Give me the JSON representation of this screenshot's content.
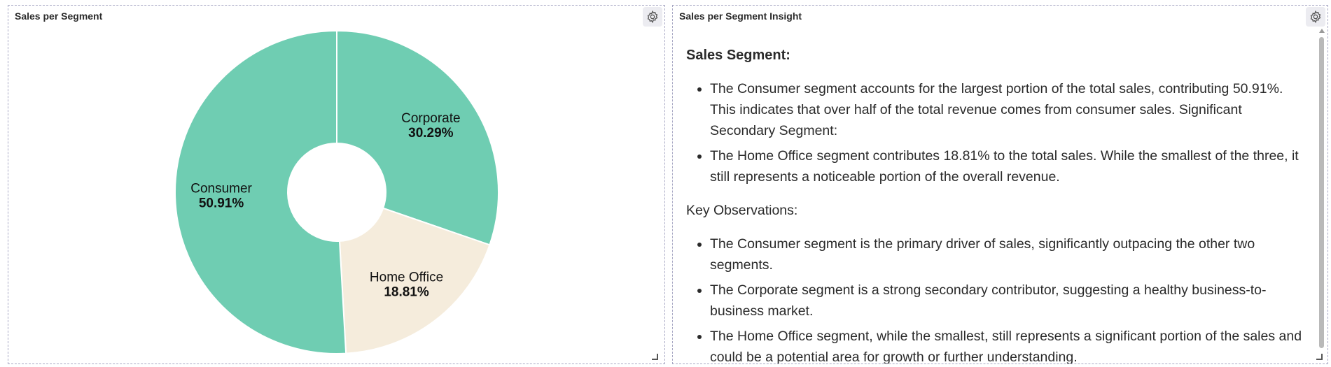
{
  "left_panel": {
    "title": "Sales per Segment",
    "settings_icon": "gear-icon"
  },
  "right_panel": {
    "title": "Sales per Segment Insight",
    "settings_icon": "gear-icon",
    "heading": "Sales Segment:",
    "list1": [
      "The Consumer segment accounts for the largest portion of the total sales, contributing 50.91%. This indicates that over half of the total revenue comes from consumer sales. Significant Secondary Segment:",
      "The Home Office segment contributes 18.81% to the total sales. While the smallest of the three, it still represents a noticeable portion of the overall revenue."
    ],
    "subheading": "Key Observations:",
    "list2": [
      "The Consumer segment is the primary driver of sales, significantly outpacing the other two segments.",
      "The Corporate segment is a strong secondary contributor, suggesting a healthy business-to-business market.",
      "The Home Office segment, while the smallest, still represents a significant portion of the sales and could be a potential area for growth or further understanding."
    ]
  },
  "chart_data": {
    "type": "pie",
    "variant": "donut",
    "categories": [
      "Corporate",
      "Home Office",
      "Consumer"
    ],
    "values": [
      30.29,
      18.81,
      50.91
    ],
    "labels": [
      "30.29%",
      "18.81%",
      "50.91%"
    ],
    "colors": [
      "#6fcdb2",
      "#f5ecdc",
      "#6fcdb2"
    ],
    "start": "12 o'clock",
    "direction": "clockwise"
  }
}
